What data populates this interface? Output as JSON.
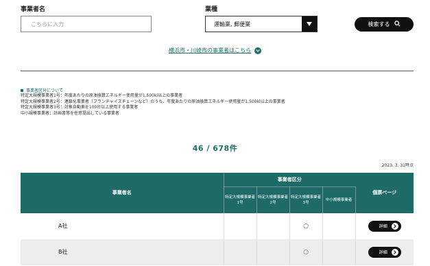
{
  "search": {
    "name_label": "事業者名",
    "name_placeholder": "こちらに入力",
    "industry_label": "業種",
    "industry_value": "運輸業, 郵便業",
    "search_button": "検索する"
  },
  "link": {
    "text": "横浜市・川崎市の事業者はこちら"
  },
  "notes": {
    "title": "事業者区分について",
    "lines": [
      "特定大規模事業者1号：年度あたりの原油換算エネルギー使用量が1,500kl以上の事業者",
      "特定大規模事業者2号：連鎖化事業者（フランチャイズチェーンなど）のうち、年度あたりの原油換算エネルギー使用量が1,500kl以上の事業者",
      "特定大規模事業者3号：対象自動車を100台以上使用する事業者",
      "中小規模事業者：計画書等を任意提出している事業者"
    ]
  },
  "result": {
    "count": "46 / 678件",
    "date": "2023. 3. 31時点"
  },
  "table": {
    "col_name": "事業者名",
    "col_group": "事業者区分",
    "col_detail": "個票ページ",
    "sub_cols": [
      "特定大規模事業者1号",
      "特定大規模事業者2号",
      "特定大規模事業者3号",
      "中小規模事業者"
    ],
    "rows": [
      {
        "name": "A社",
        "marks": [
          "",
          "",
          "○",
          ""
        ],
        "detail": "詳細"
      },
      {
        "name": "B社",
        "marks": [
          "",
          "",
          "○",
          ""
        ],
        "detail": "詳細"
      }
    ]
  },
  "colors": {
    "accent": "#1d6a66",
    "dark": "#111111"
  }
}
